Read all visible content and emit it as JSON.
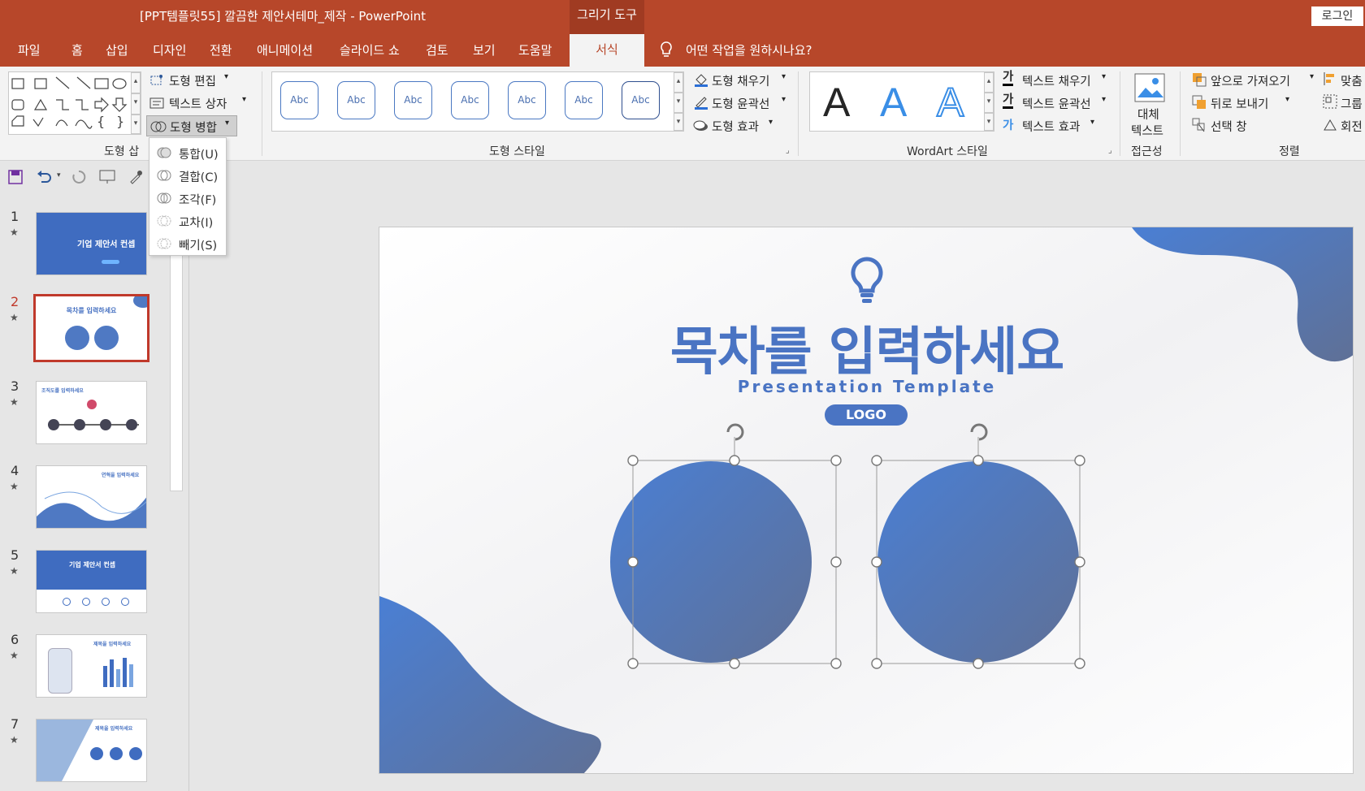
{
  "window": {
    "title": "[PPT템플릿55] 깔끔한 제안서테마_제작  -  PowerPoint",
    "context_group": "그리기 도구",
    "login": "로그인"
  },
  "tabs": [
    "파일",
    "홈",
    "삽입",
    "디자인",
    "전환",
    "애니메이션",
    "슬라이드 쇼",
    "검토",
    "보기",
    "도움말"
  ],
  "active_tab": "서식",
  "tell_me": "어떤 작업을 원하시나요?",
  "ribbon": {
    "insert_shapes": {
      "edit_shape": "도형 편집",
      "text_box": "텍스트 상자",
      "merge_shapes": "도형 병합",
      "label": "도형 삽"
    },
    "shape_styles": {
      "sample": "Abc",
      "fill": "도형 채우기",
      "outline": "도형 윤곽선",
      "effects": "도형 효과",
      "label": "도형 스타일"
    },
    "wordart": {
      "letter": "A",
      "text_fill": "텍스트 채우기",
      "text_outline": "텍스트 윤곽선",
      "text_effects": "텍스트 효과",
      "label": "WordArt 스타일",
      "fill_icon_glyph": "가"
    },
    "accessibility": {
      "alt_text_1": "대체",
      "alt_text_2": "텍스트",
      "label": "접근성"
    },
    "arrange": {
      "bring_forward": "앞으로 가져오기",
      "send_backward": "뒤로 보내기",
      "selection_pane": "선택 창",
      "align": "맞춤",
      "group": "그룹",
      "rotate": "회전",
      "label": "정렬"
    }
  },
  "merge_menu": [
    "통합(U)",
    "결합(C)",
    "조각(F)",
    "교차(I)",
    "빼기(S)"
  ],
  "slides": [
    {
      "num": "1",
      "title": "기업 제안서 컨셉"
    },
    {
      "num": "2",
      "title": "목차를 입력하세요"
    },
    {
      "num": "3",
      "title": "조직도를 입력하세요"
    },
    {
      "num": "4",
      "title": "연혁을 입력하세요"
    },
    {
      "num": "5",
      "title": "기업 제안서 컨셉"
    },
    {
      "num": "6",
      "title": "제목을 입력하세요"
    },
    {
      "num": "7",
      "title": "제목을 입력하세요"
    }
  ],
  "selected_slide": 2,
  "slide_star": "★",
  "slide": {
    "title": "목차를 입력하세요",
    "subtitle": "Presentation Template",
    "logo": "LOGO"
  },
  "colors": {
    "accent": "#b7472a",
    "brand_blue": "#4a74c3",
    "blue_dark": "#5f7096"
  }
}
